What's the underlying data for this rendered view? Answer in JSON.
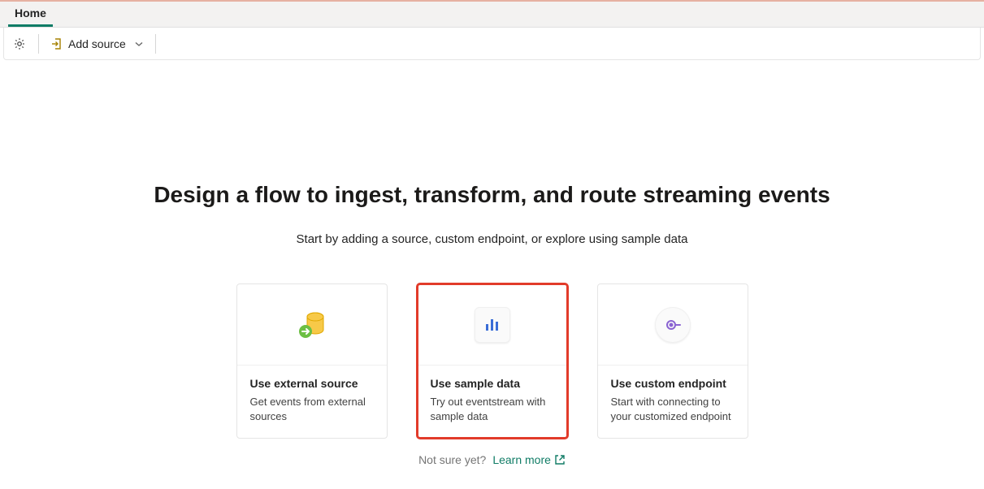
{
  "tabs": {
    "home": "Home"
  },
  "toolbar": {
    "add_source_label": "Add source"
  },
  "main": {
    "heading": "Design a flow to ingest, transform, and route streaming events",
    "subtitle": "Start by adding a source, custom endpoint, or explore using sample data"
  },
  "cards": {
    "external": {
      "title": "Use external source",
      "desc": "Get events from external sources"
    },
    "sample": {
      "title": "Use sample data",
      "desc": "Try out eventstream with sample data"
    },
    "custom": {
      "title": "Use custom endpoint",
      "desc": "Start with connecting to your customized endpoint"
    }
  },
  "footer": {
    "prompt": "Not sure yet?",
    "learn_more": "Learn more"
  }
}
